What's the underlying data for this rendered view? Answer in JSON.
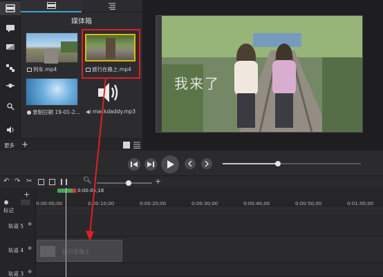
{
  "media_bin": {
    "title": "媒体箱",
    "items": [
      {
        "label": "列车.mp4",
        "type": "video"
      },
      {
        "label": "旅行在路上.mp4",
        "type": "video",
        "selected": true
      },
      {
        "label": "录制日期 19-01-2...",
        "type": "recording"
      },
      {
        "label": "mackdaddy.mp3",
        "type": "audio"
      }
    ],
    "more_label": "更多"
  },
  "preview": {
    "overlay_text": "我来了"
  },
  "timeline": {
    "playhead_time": "0:00:05;18",
    "marker_label": "标记",
    "ruler_ticks": [
      "0:00:00;00",
      "0:00:10;00",
      "0:00:20;00",
      "0:00:30;00",
      "0:00:40;00",
      "0:00:50;00",
      "0:01:00;00"
    ],
    "tracks": [
      "轨道 5",
      "轨道 4",
      "轨道 3"
    ],
    "drag_clip_label": "旅行在路上"
  },
  "colors": {
    "selection_red": "#e02020",
    "accent_blue": "#3aa6d6",
    "selected_thumb_border": "#e6b800",
    "playhead_green": "#4aa35a"
  }
}
